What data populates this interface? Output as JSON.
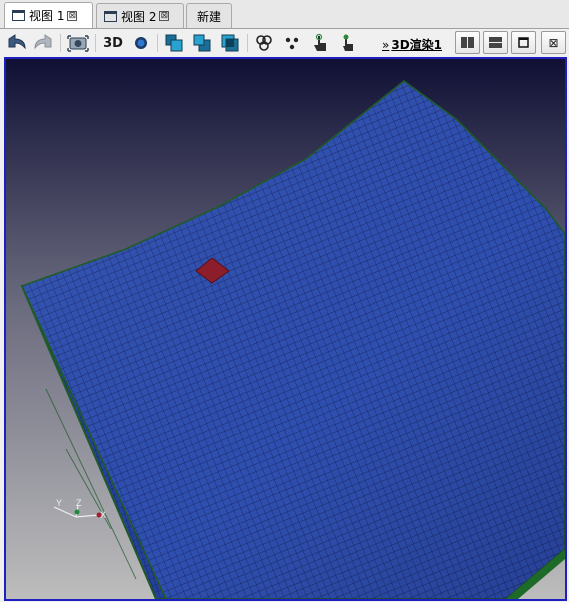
{
  "tabs": [
    {
      "label": "视图 1",
      "close": "⊠"
    },
    {
      "label": "视图 2",
      "close": "⊠"
    },
    {
      "label": "新建"
    }
  ],
  "toolbar": {
    "back_icon": "arrow-back-icon",
    "forward_icon": "arrow-forward-icon",
    "camera_icon": "camera-icon",
    "mode_3d_label": "3D",
    "render_label": "3D渲染1",
    "render_arrows": "»"
  },
  "window_buttons": {
    "close": "⊠"
  },
  "axis": {
    "x": "X",
    "y": "Y",
    "z": "Z"
  },
  "colors": {
    "mesh": "#2f4fb0",
    "mesh_lines": "#1a2a6a",
    "highlight": "#8b1e2a",
    "edges": "#1e5a28",
    "bg_top": "#1a1a40",
    "bg_bottom": "#c8c8c8",
    "frame": "#1f1fbf"
  }
}
